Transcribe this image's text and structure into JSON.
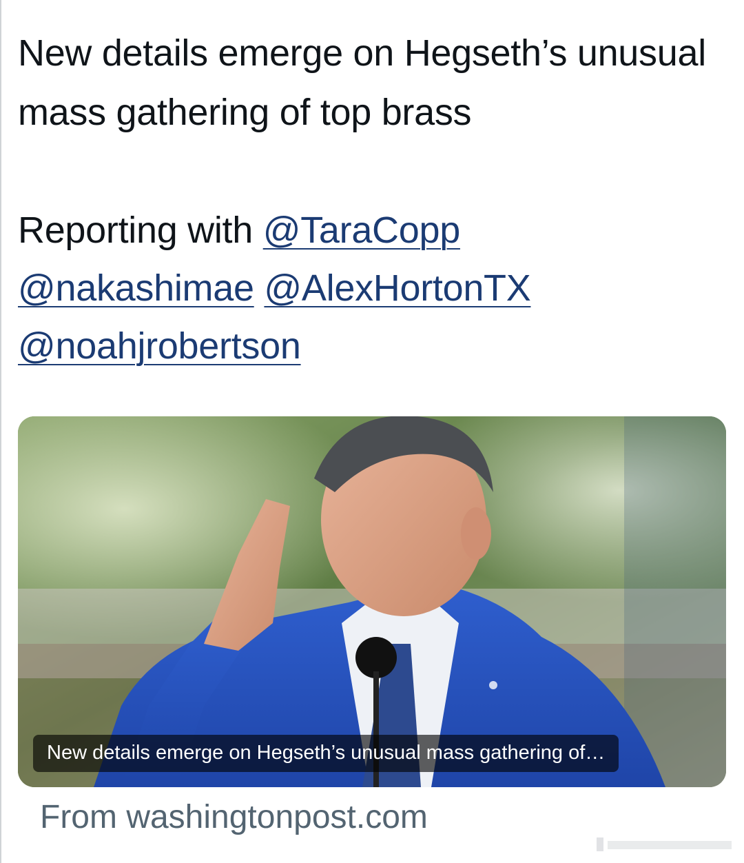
{
  "tweet": {
    "headline": "New details emerge on Hegseth’s unusual mass gathering of top brass",
    "byline_prefix": "Reporting with",
    "mentions": [
      "@TaraCopp",
      "@nakashimae",
      "@AlexHortonTX",
      "@noahjrobertson"
    ]
  },
  "card": {
    "caption": "New details emerge on Hegseth’s unusual mass gathering of…",
    "image_icon": "photo-of-saluting-man",
    "source_text": "From washingtonpost.com"
  },
  "colors": {
    "mention": "#1b3b73",
    "source": "#536471",
    "text": "#0f1419"
  }
}
